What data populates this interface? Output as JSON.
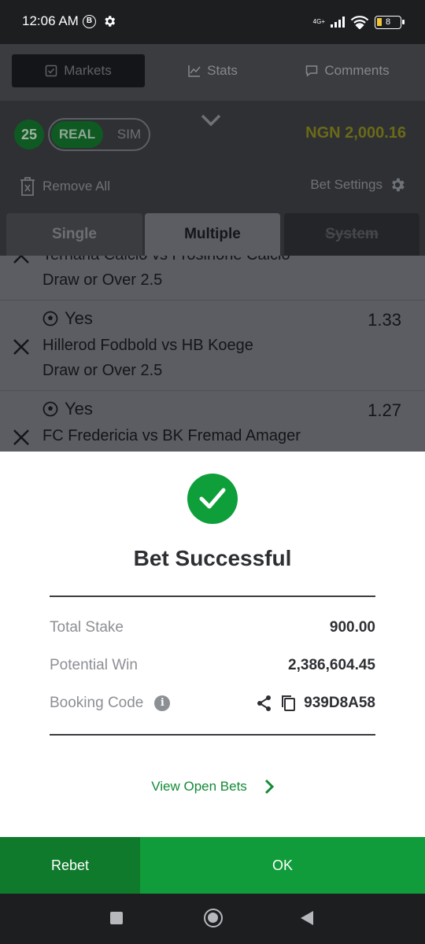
{
  "status_bar": {
    "time": "12:06 AM",
    "b_badge": "B",
    "network": "4G+",
    "battery": "8"
  },
  "top_nav": {
    "tabs": [
      {
        "label": "Markets",
        "icon": "checkbox-icon"
      },
      {
        "label": "Stats",
        "icon": "chart-icon"
      },
      {
        "label": "Comments",
        "icon": "comment-icon"
      }
    ]
  },
  "bet_header": {
    "count": "25",
    "mode_real": "REAL",
    "mode_sim": "SIM",
    "balance": "NGN 2,000.16",
    "remove_all": "Remove All",
    "bet_settings": "Bet Settings"
  },
  "slip_tabs": {
    "single": "Single",
    "multiple": "Multiple",
    "system": "System"
  },
  "selections": [
    {
      "pick": "",
      "odds": "",
      "match": "Ternana Calcio vs Frosinone Calcio",
      "market": "Draw or Over 2.5"
    },
    {
      "pick": "Yes",
      "odds": "1.33",
      "match": "Hillerod Fodbold vs HB Koege",
      "market": "Draw or Over 2.5"
    },
    {
      "pick": "Yes",
      "odds": "1.27",
      "match": "FC Fredericia vs BK Fremad Amager",
      "market": ""
    }
  ],
  "modal": {
    "title": "Bet Successful",
    "total_stake_label": "Total Stake",
    "total_stake": "900.00",
    "potential_win_label": "Potential Win",
    "potential_win": "2,386,604.45",
    "booking_code_label": "Booking Code",
    "booking_code": "939D8A58",
    "view_open_bets": "View Open Bets",
    "rebet": "Rebet",
    "ok": "OK"
  },
  "colors": {
    "accent_green": "#109c3b",
    "dark_green": "#0f7a2c",
    "balance_yellow": "#6b6a17"
  }
}
